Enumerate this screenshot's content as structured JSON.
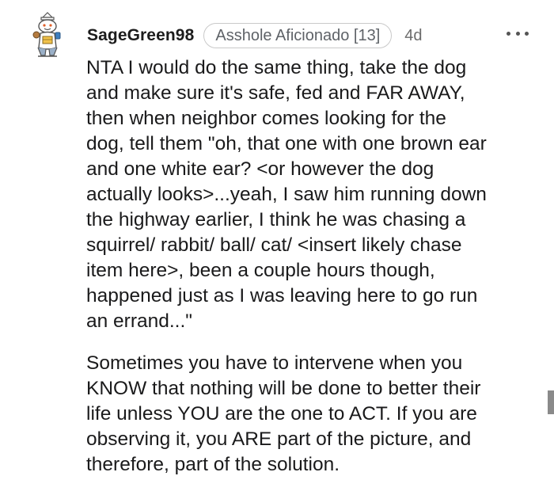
{
  "comment": {
    "author": {
      "username": "SageGreen98",
      "avatar_icon": "snoo-avatar-icon"
    },
    "flair": "Asshole Aficionado [13]",
    "age": "4d",
    "more_icon": "more-options-icon",
    "paragraphs": [
      "NTA I would do the same thing, take the dog\nand make sure it's safe, fed and FAR AWAY,\nthen when neighbor comes looking for the\ndog, tell them \"oh, that one with one brown ear\nand one white ear? <or however the dog\nactually looks>...yeah, I saw him running down\nthe highway earlier, I think he was chasing a\nsquirrel/ rabbit/ ball/ cat/ <insert likely chase\nitem here>, been a couple hours though,\nhappened just as I was leaving here to go run\nan errand...\"",
      "Sometimes you have to intervene when you\nKNOW that nothing will be done to better their\nlife unless YOU are the one to ACT. If you are\nobserving it, you ARE part of the picture, and\ntherefore, part of the solution."
    ]
  }
}
